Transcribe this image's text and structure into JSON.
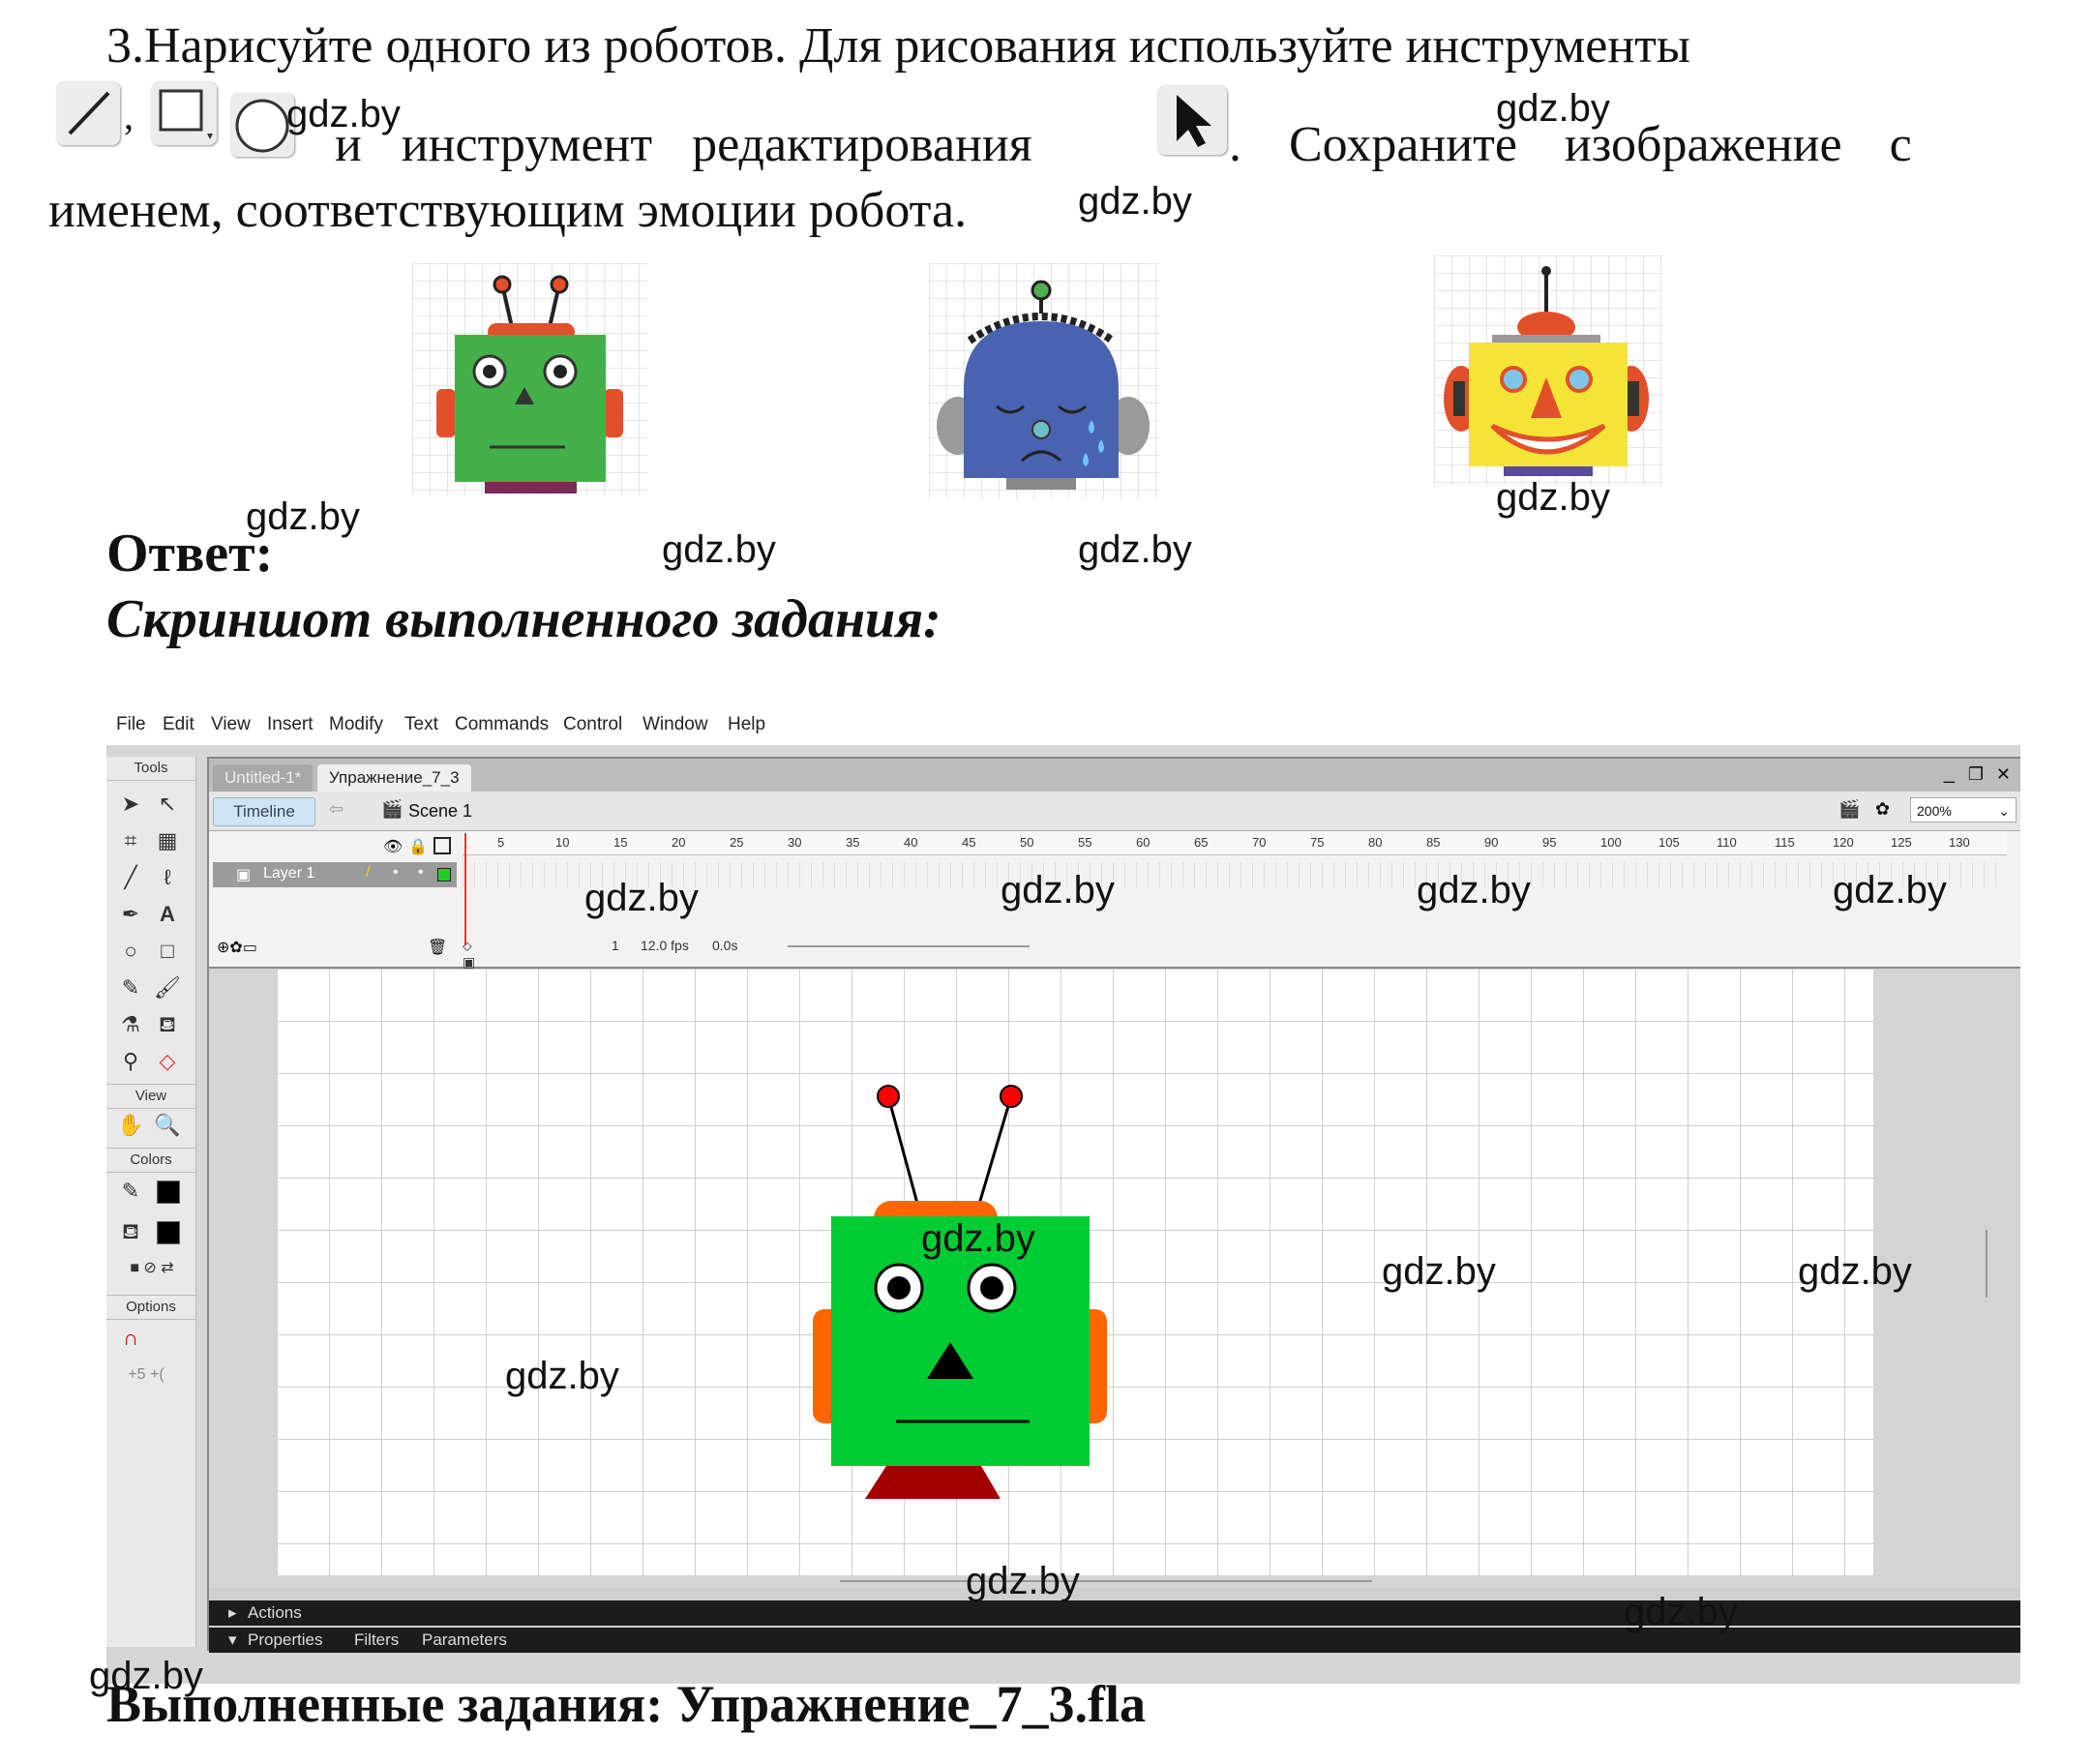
{
  "task": {
    "line1": "3.Нарисуйте одного из роботов. Для рисования используйте инструменты",
    "line2_part1": "и инструмент редактирования",
    "line2_part2": ". Сохраните изображение с",
    "line3": "именем, соответствующим эмоции робота.",
    "comma": ","
  },
  "tool_icons": [
    "line-tool-icon",
    "rectangle-tool-icon",
    "oval-tool-icon",
    "selection-tool-icon"
  ],
  "robots": [
    {
      "name": "green-robot",
      "face": "#44b04a",
      "ears": "#e2502a",
      "top": "#e2502a"
    },
    {
      "name": "blue-robot",
      "face": "#4a63b0",
      "ears": "#9a9a9a",
      "top": "#222222"
    },
    {
      "name": "yellow-robot",
      "face": "#f4e437",
      "ears": "#e2502a",
      "top": "#e2502a"
    }
  ],
  "answer": {
    "label": "Ответ:",
    "sub": "Скриншот выполненного задания:",
    "done": "Выполненные задания: Упражнение_7_3.fla"
  },
  "watermark": "gdz.by",
  "flash": {
    "menu": [
      "File",
      "Edit",
      "View",
      "Insert",
      "Modify",
      "Text",
      "Commands",
      "Control",
      "Window",
      "Help"
    ],
    "panel_tools": "Tools",
    "panel_view": "View",
    "panel_colors": "Colors",
    "panel_options": "Options",
    "tabs": [
      "Untitled-1*",
      "Упражнение_7_3"
    ],
    "timeline_button": "Timeline",
    "scene": "Scene 1",
    "zoom": "200%",
    "layer": "Layer 1",
    "frame_ticks": [
      "5",
      "10",
      "15",
      "20",
      "25",
      "30",
      "35",
      "40",
      "45",
      "50",
      "55",
      "60",
      "65",
      "70",
      "75",
      "80",
      "85",
      "90",
      "95",
      "100",
      "105",
      "110",
      "115",
      "120",
      "125",
      "130"
    ],
    "frame": "1",
    "fps": "12.0 fps",
    "time": "0.0s",
    "actions": "Actions",
    "bottom_tabs": [
      "Properties",
      "Filters",
      "Parameters"
    ],
    "window_controls": [
      "_",
      "❐",
      "✕"
    ],
    "colors": {
      "head": "#00cc33",
      "top": "#ff6600",
      "ears": "#ff6600",
      "neck": "#a50000",
      "antenna_tip": "#ff0000"
    }
  }
}
